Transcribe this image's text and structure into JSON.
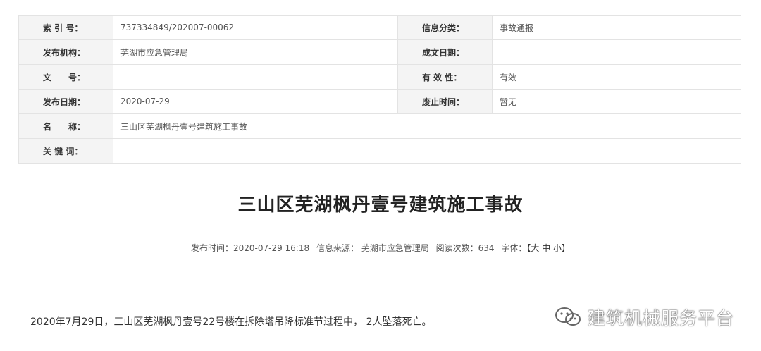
{
  "info_table": {
    "rows": [
      {
        "label1": "索 引 号：",
        "value1": "737334849/202007-00062",
        "label2": "信息分类：",
        "value2": "事故通报"
      },
      {
        "label1": "发布机构：",
        "value1": "芜湖市应急管理局",
        "label2": "成文日期：",
        "value2": ""
      },
      {
        "label1": "文　　号：",
        "value1": "",
        "label2": "有 效 性：",
        "value2": "有效"
      },
      {
        "label1": "发布日期：",
        "value1": "2020-07-29",
        "label2": "废止时间：",
        "value2": "暂无"
      },
      {
        "label1": "名　　称：",
        "value1": "三山区芜湖枫丹壹号建筑施工事故"
      },
      {
        "label1": "关 键 词：",
        "value1": ""
      }
    ]
  },
  "article": {
    "title": "三山区芜湖枫丹壹号建筑施工事故",
    "meta": {
      "publish_time": "发布时间：2020-07-29 16:18",
      "source": "信息来源： 芜湖市应急管理局",
      "views": "阅读次数：634",
      "font_label": "字体：",
      "font_sizes": "【大 中 小】"
    },
    "body": "2020年7月29日，三山区芜湖枫丹壹号22号楼在拆除塔吊降标准节过程中， 2人坠落死亡。"
  },
  "watermark": {
    "text": "建筑机械服务平台",
    "icon": "wechat-icon"
  }
}
